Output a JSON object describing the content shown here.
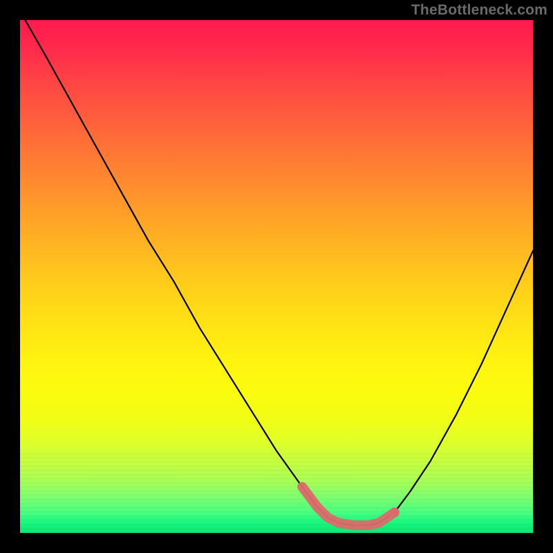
{
  "watermark": "TheBottleneck.com",
  "chart_data": {
    "type": "line",
    "title": "",
    "xlabel": "",
    "ylabel": "",
    "xlim": [
      0,
      100
    ],
    "ylim": [
      0,
      100
    ],
    "series": [
      {
        "name": "bottleneck-curve",
        "x": [
          1,
          5,
          10,
          15,
          20,
          25,
          30,
          35,
          40,
          45,
          50,
          55,
          58,
          60,
          62,
          65,
          68,
          70,
          73,
          76,
          80,
          85,
          90,
          95,
          100
        ],
        "y": [
          100,
          93,
          84,
          75,
          66,
          57,
          49,
          40,
          32,
          24,
          16,
          9,
          5,
          3,
          2,
          1.5,
          1.5,
          2,
          4,
          8,
          14,
          23,
          33,
          44,
          55
        ]
      }
    ],
    "highlight": {
      "name": "optimal-zone",
      "x": [
        55,
        58,
        60,
        62,
        65,
        68,
        70,
        73
      ],
      "y": [
        9,
        5,
        3,
        2,
        1.5,
        1.5,
        2,
        4
      ],
      "marker_x": 73,
      "marker_y": 4
    },
    "background_gradient": {
      "top_color": "#ff1a4f",
      "mid_color": "#ffe414",
      "bottom_color": "#0de874"
    }
  }
}
